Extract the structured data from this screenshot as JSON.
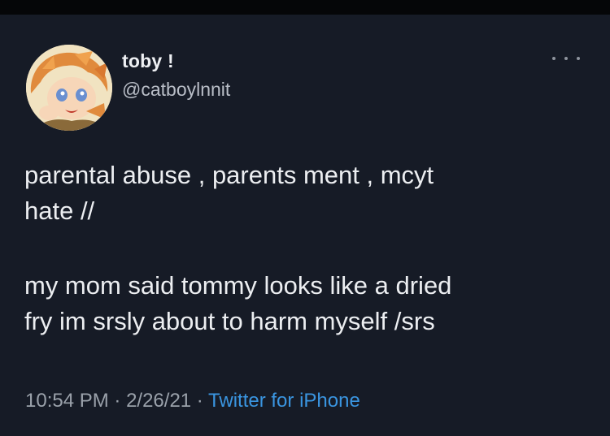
{
  "tweet": {
    "display_name": "toby !",
    "handle": "@catboylnnit",
    "body": [
      "parental abuse , parents ment , mcyt\nhate //",
      "my mom said tommy looks like a dried\nfry im srsly about to harm myself /srs"
    ],
    "time": "10:54 PM",
    "separator": " · ",
    "date": "2/26/21",
    "source": "Twitter for iPhone"
  },
  "icons": {
    "avatar": "avatar-image",
    "more": "more-options-icon"
  },
  "colors": {
    "background": "#161b26",
    "link": "#3a95e0",
    "text": "#eceef1",
    "muted": "#9aa1aa"
  }
}
